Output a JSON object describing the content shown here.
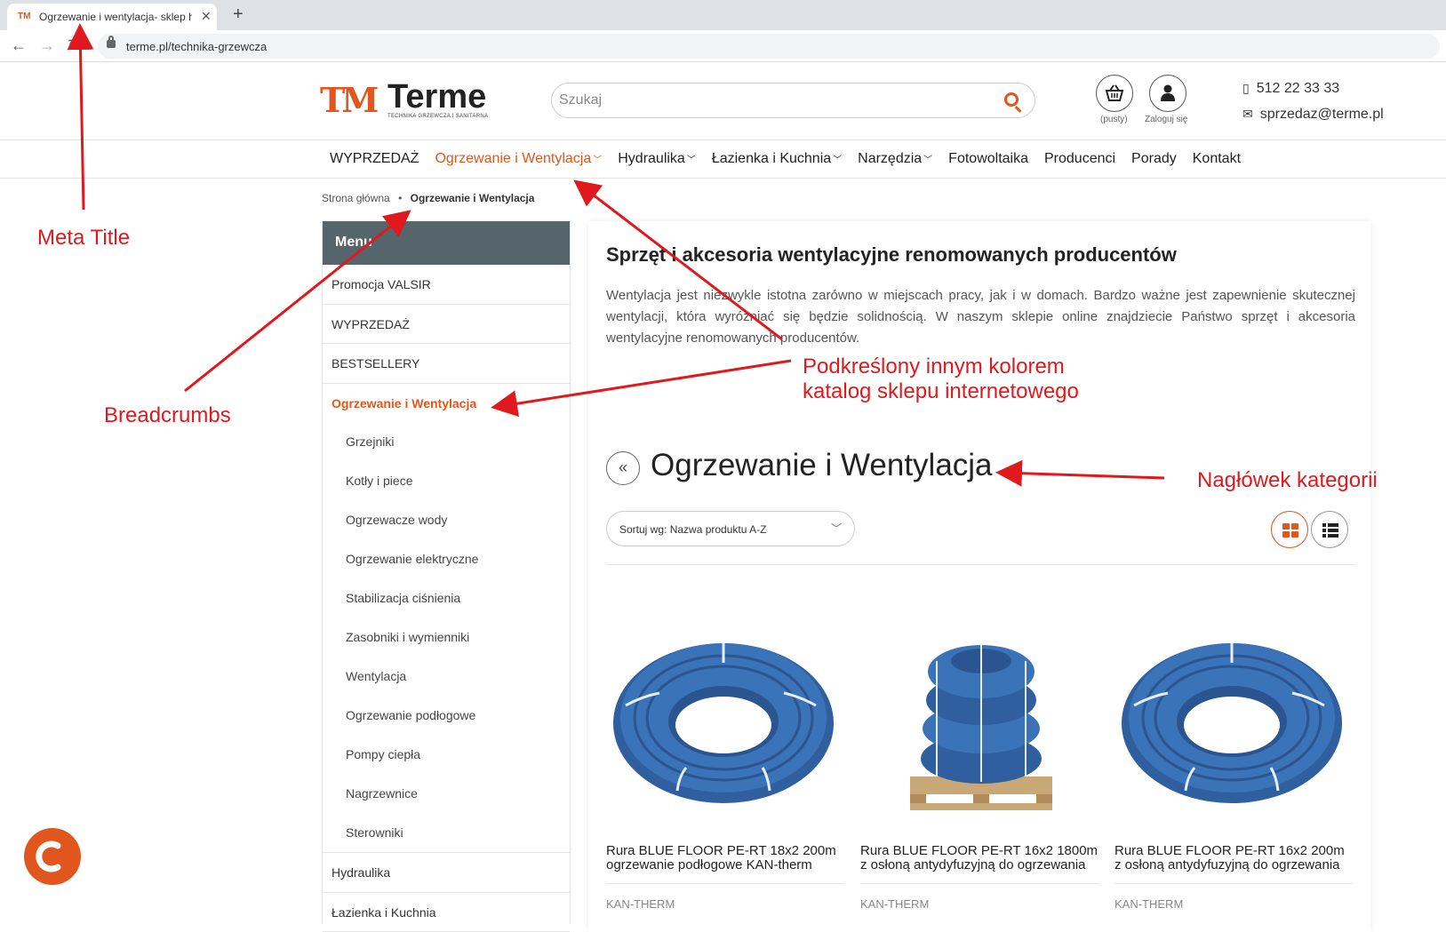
{
  "browser": {
    "tab_title": "Ogrzewanie i wentylacja- sklep h",
    "favicon_text": "TM",
    "new_tab": "+",
    "url": "terme.pl/technika-grzewcza"
  },
  "header": {
    "logo_mark": "TM",
    "logo_name": "Terme",
    "logo_tagline": "TECHNIKA GRZEWCZA I SANITARNA",
    "search_placeholder": "Szukaj",
    "cart_label": "(pusty)",
    "login_label": "Zaloguj się",
    "phone": "512 22 33 33",
    "email": "sprzedaz@terme.pl"
  },
  "nav": {
    "items": [
      {
        "label": "WYPRZEDAŻ",
        "dropdown": false
      },
      {
        "label": "Ogrzewanie i Wentylacja",
        "dropdown": true
      },
      {
        "label": "Hydraulika",
        "dropdown": true
      },
      {
        "label": "Łazienka i Kuchnia",
        "dropdown": true
      },
      {
        "label": "Narzędzia",
        "dropdown": true
      },
      {
        "label": "Fotowoltaika",
        "dropdown": false
      },
      {
        "label": "Producenci",
        "dropdown": false
      },
      {
        "label": "Porady",
        "dropdown": false
      },
      {
        "label": "Kontakt",
        "dropdown": false
      }
    ],
    "active_index": 1
  },
  "breadcrumb": {
    "home": "Strona główna",
    "separator": "•",
    "current": "Ogrzewanie i Wentylacja"
  },
  "sidebar": {
    "heading": "Menu",
    "top_items": [
      "Promocja VALSIR",
      "WYPRZEDAŻ",
      "BESTSELLERY"
    ],
    "active_item": "Ogrzewanie i Wentylacja",
    "sub_items": [
      "Grzejniki",
      "Kotły i piece",
      "Ogrzewacze wody",
      "Ogrzewanie elektryczne",
      "Stabilizacja ciśnienia",
      "Zasobniki i wymienniki",
      "Wentylacja",
      "Ogrzewanie podłogowe",
      "Pompy ciepła",
      "Nagrzewnice",
      "Sterowniki"
    ],
    "bottom_items": [
      "Hydraulika",
      "Łazienka i Kuchnia"
    ]
  },
  "content": {
    "intro_title": "Sprzęt i akcesoria wentylacyjne renomowanych producentów",
    "intro_text": "Wentylacja jest niezwykle istotna zarówno w miejscach pracy, jak i w domach. Bardzo ważne jest zapewnienie skutecznej wentylacji, która wyróżniać się będzie solidnością. W naszym sklepie online znajdziecie Państwo sprzęt i akcesoria wentylacyjne renomowanych producentów.",
    "back_icon": "«",
    "category_heading": "Ogrzewanie i Wentylacja",
    "sort_label": "Sortuj wg: Nazwa produktu A-Z",
    "products": [
      {
        "title": "Rura BLUE FLOOR PE-RT 18x2 200m ogrzewanie podłogowe KAN-therm",
        "brand": "KAN-THERM"
      },
      {
        "title": "Rura BLUE FLOOR PE-RT 16x2 1800m z osłoną antydyfuzyjną do ogrzewania",
        "brand": "KAN-THERM"
      },
      {
        "title": "Rura BLUE FLOOR PE-RT 16x2 200m z osłoną antydyfuzyjną do ogrzewania",
        "brand": "KAN-THERM"
      }
    ]
  },
  "annotations": {
    "meta_title": "Meta Title",
    "breadcrumbs": "Breadcrumbs",
    "catalog_line1": "Podkreślony innym kolorem",
    "catalog_line2": "katalog sklepu internetowego",
    "heading": "Nagłówek kategorii"
  },
  "colors": {
    "accent": "#e0561d",
    "annotation": "#e0191e",
    "sidebar_header": "#56646c",
    "pipe_blue": "#3a73b8"
  },
  "icons": [
    "back-arrow-icon",
    "forward-arrow-icon",
    "reload-icon",
    "lock-icon",
    "search-icon",
    "basket-icon",
    "user-icon",
    "phone-icon",
    "envelope-icon",
    "chevron-down-icon",
    "grid-view-icon",
    "list-view-icon",
    "phone-call-icon"
  ]
}
